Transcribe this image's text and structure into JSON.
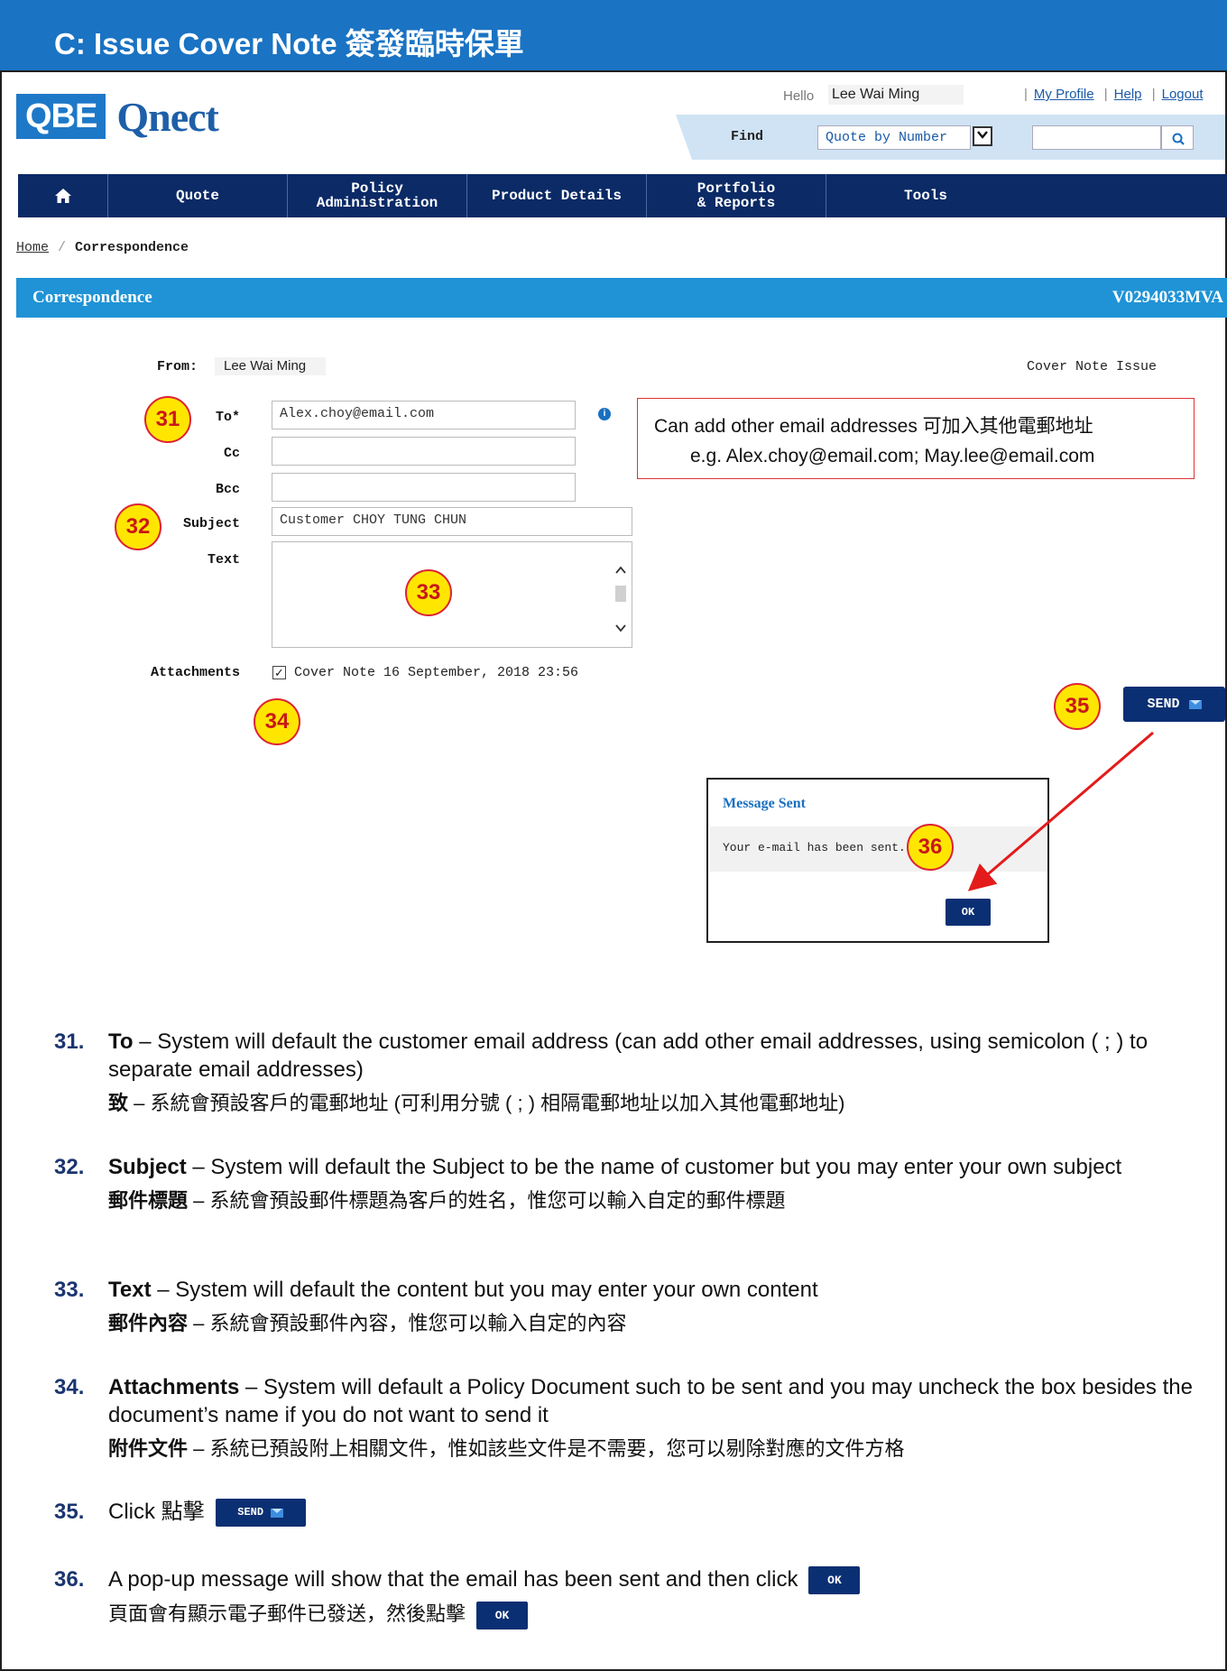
{
  "banner": {
    "title": "C: Issue Cover Note 簽發臨時保單"
  },
  "logo": {
    "box": "QBE",
    "text": "Qnect"
  },
  "header": {
    "hello_label": "Hello",
    "user_name": "Lee Wai Ming",
    "links": [
      "My Profile",
      "Help",
      "Logout"
    ],
    "find_label": "Find",
    "find_select": "Quote by Number"
  },
  "nav": {
    "home_icon": "home-icon",
    "items": [
      "Quote",
      "Policy Administration",
      "Product Details",
      "Portfolio & Reports",
      "Tools"
    ]
  },
  "breadcrumb": {
    "home": "Home",
    "current": "Correspondence"
  },
  "section": {
    "title": "Correspondence",
    "ref": "V0294033MVA"
  },
  "form": {
    "from_label": "From:",
    "from_value": "Lee Wai Ming",
    "doc_type": "Cover Note Issue",
    "to_label": "To*",
    "to_value": "Alex.choy@email.com",
    "cc_label": "Cc",
    "bcc_label": "Bcc",
    "subject_label": "Subject",
    "subject_value": "Customer CHOY TUNG CHUN",
    "text_label": "Text",
    "attachments_label": "Attachments",
    "attachment_name": "Cover Note 16 September, 2018 23:56",
    "send_label": "SEND"
  },
  "note": {
    "line1": "Can add other email addresses 可加入其他電郵地址",
    "line2": "e.g. Alex.choy@email.com; May.lee@email.com"
  },
  "badges": [
    "31",
    "32",
    "33",
    "34",
    "35",
    "36"
  ],
  "popup": {
    "title": "Message Sent",
    "body": "Your e-mail has been sent.",
    "ok": "OK"
  },
  "instructions": [
    {
      "num": "31.",
      "term": "To",
      "en": " – System will default the customer email address (can add other email addresses, using semicolon ( ; ) to separate email addresses)",
      "zh_term": "致",
      "zh": " – 系統會預設客戶的電郵地址 (可利用分號 ( ; ) 相隔電郵地址以加入其他電郵地址)"
    },
    {
      "num": "32.",
      "term": "Subject",
      "en": " – System will default the Subject to be the name of customer but you may enter your own subject",
      "zh_term": "郵件標題",
      "zh": " – 系統會預設郵件標題為客戶的姓名，惟您可以輸入自定的郵件標題"
    },
    {
      "num": "33.",
      "term": "Text",
      "en": " – System will default the content but you may enter your own content",
      "zh_term": "郵件內容",
      "zh": " – 系統會預設郵件內容，惟您可以輸入自定的內容"
    },
    {
      "num": "34.",
      "term": "Attachments",
      "en": " – System will default a Policy Document such to be sent and you may uncheck the box besides the document’s name if you do not want to send it",
      "zh_term": "附件文件",
      "zh": " – 系統已預設附上相關文件，惟如該些文件是不需要，您可以剔除對應的文件方格"
    },
    {
      "num": "35.",
      "en": "Click 點擊",
      "button": "SEND"
    },
    {
      "num": "36.",
      "en": "A pop-up message will show that the email has been sent and then click",
      "zh": "頁面會有顯示電子郵件已發送，然後點擊",
      "button": "OK"
    }
  ]
}
